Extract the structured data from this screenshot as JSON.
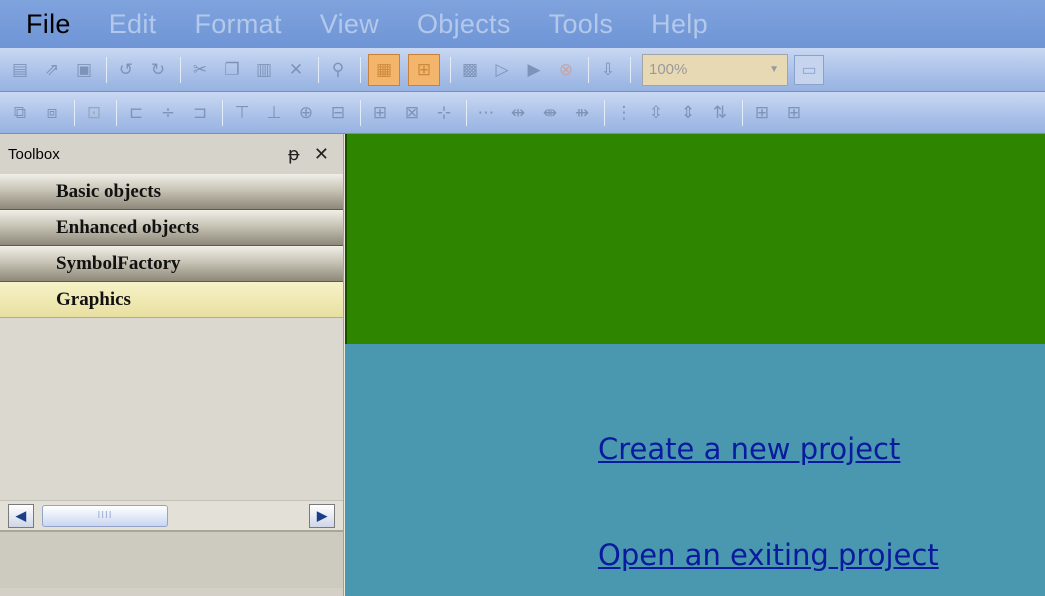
{
  "menu": {
    "items": [
      {
        "label": "File",
        "enabled": true
      },
      {
        "label": "Edit",
        "enabled": false
      },
      {
        "label": "Format",
        "enabled": false
      },
      {
        "label": "View",
        "enabled": false
      },
      {
        "label": "Objects",
        "enabled": false
      },
      {
        "label": "Tools",
        "enabled": false
      },
      {
        "label": "Help",
        "enabled": false
      }
    ]
  },
  "toolbar1": {
    "zoom_value": "100%"
  },
  "toolbox": {
    "title": "Toolbox",
    "pin_glyph": "ᵽ",
    "close_glyph": "✕",
    "categories": [
      {
        "label": "Basic objects"
      },
      {
        "label": "Enhanced objects"
      },
      {
        "label": "SymbolFactory"
      },
      {
        "label": "Graphics",
        "selected": true
      }
    ],
    "scroll_thumb_grip": "IIII"
  },
  "start": {
    "create_link": "Create a new project",
    "open_link": "Open an exiting project"
  },
  "colors": {
    "banner": "#2e8600",
    "start_background": "#4a98af",
    "link": "#0a1a9f",
    "menubar": "#6f95d6",
    "toolbox": "#d4d0c8",
    "selected_category": "#ece4a8"
  }
}
